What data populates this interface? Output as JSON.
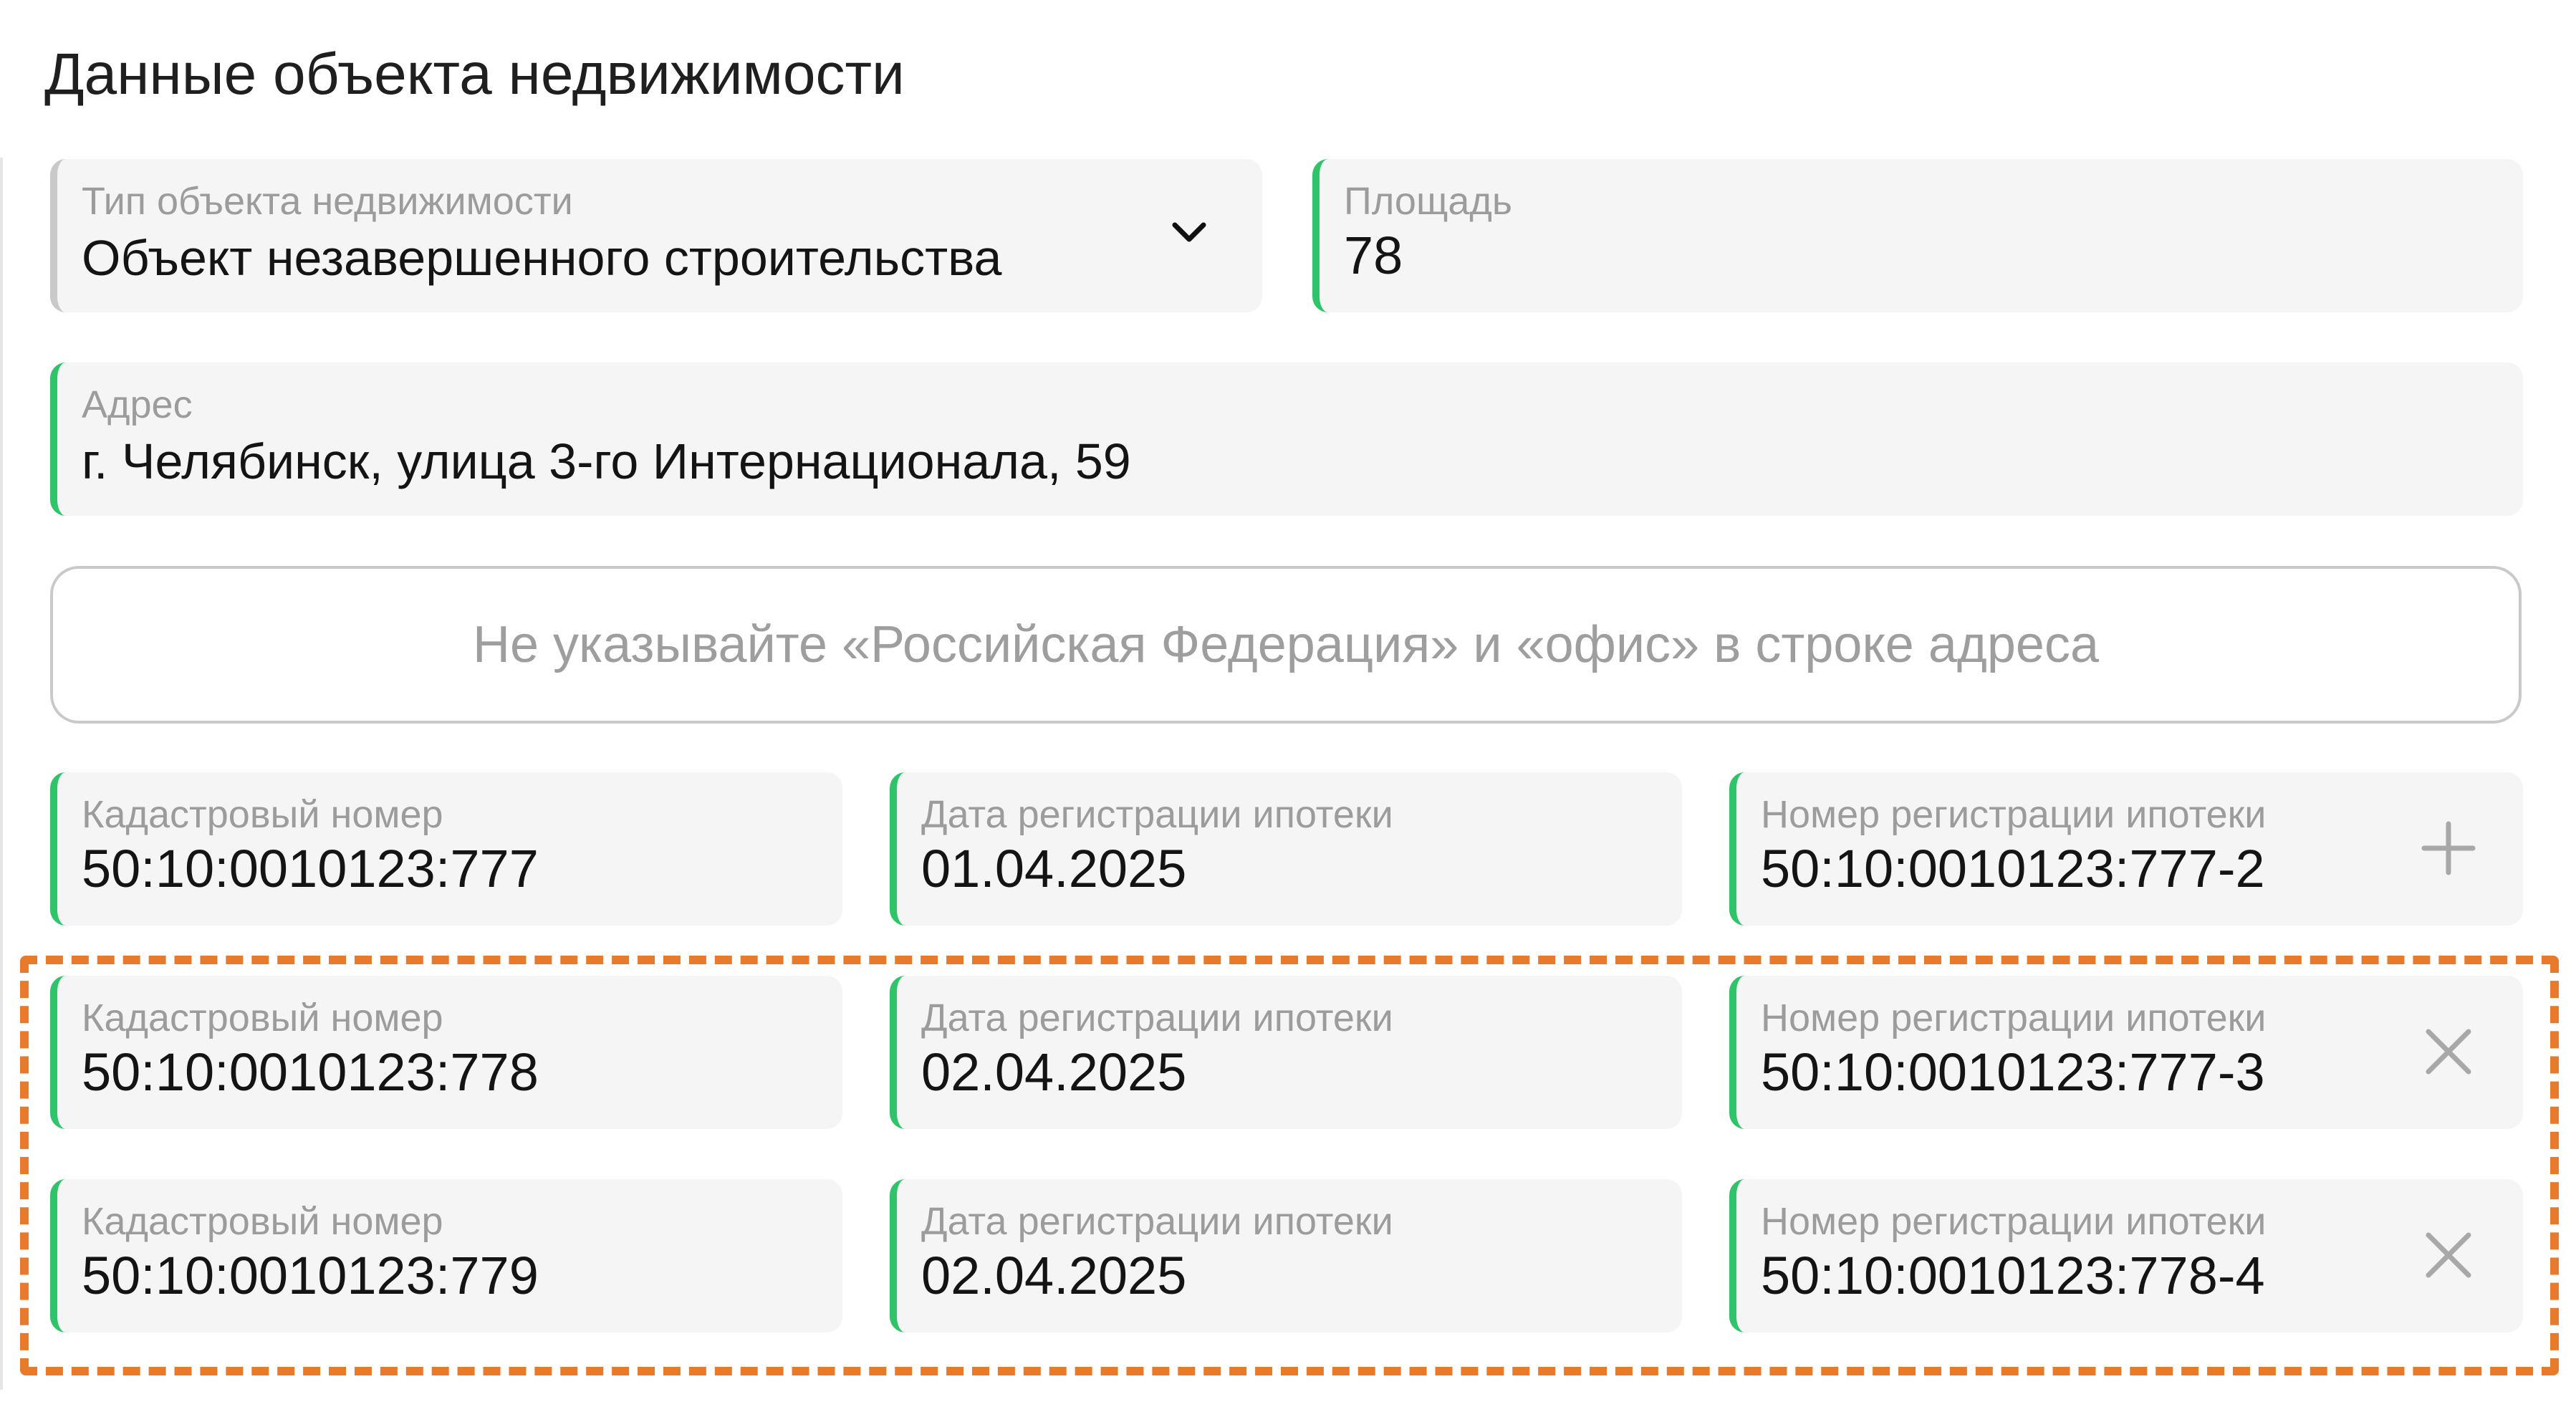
{
  "section": {
    "title": "Данные объекта недвижимости"
  },
  "property_type": {
    "label": "Тип объекта недвижимости",
    "value": "Объект незавершенного строительства"
  },
  "area": {
    "label": "Площадь",
    "value": "78"
  },
  "address": {
    "label": "Адрес",
    "value": "г. Челябинск, улица 3-го Интернационала, 59"
  },
  "address_hint": "Не указывайте «Российская Федерация» и «офис» в строке адреса",
  "cadastral_rows": [
    {
      "cadastral_label": "Кадастровый номер",
      "cadastral_value": "50:10:0010123:777",
      "date_label": "Дата регистрации ипотеки",
      "date_value": "01.04.2025",
      "reg_label": "Номер регистрации ипотеки",
      "reg_value": "50:10:0010123:777-2",
      "action": "add-icon"
    },
    {
      "cadastral_label": "Кадастровый номер",
      "cadastral_value": "50:10:0010123:778",
      "date_label": "Дата регистрации ипотеки",
      "date_value": "02.04.2025",
      "reg_label": "Номер регистрации ипотеки",
      "reg_value": "50:10:0010123:777-3",
      "action": "remove-icon"
    },
    {
      "cadastral_label": "Кадастровый номер",
      "cadastral_value": "50:10:0010123:779",
      "date_label": "Дата регистрации ипотеки",
      "date_value": "02.04.2025",
      "reg_label": "Номер регистрации ипотеки",
      "reg_value": "50:10:0010123:778-4",
      "action": "remove-icon"
    }
  ],
  "colors": {
    "accent_green": "#2fc46a",
    "highlight_orange": "#e87a2c",
    "field_bg": "#f5f5f5"
  }
}
